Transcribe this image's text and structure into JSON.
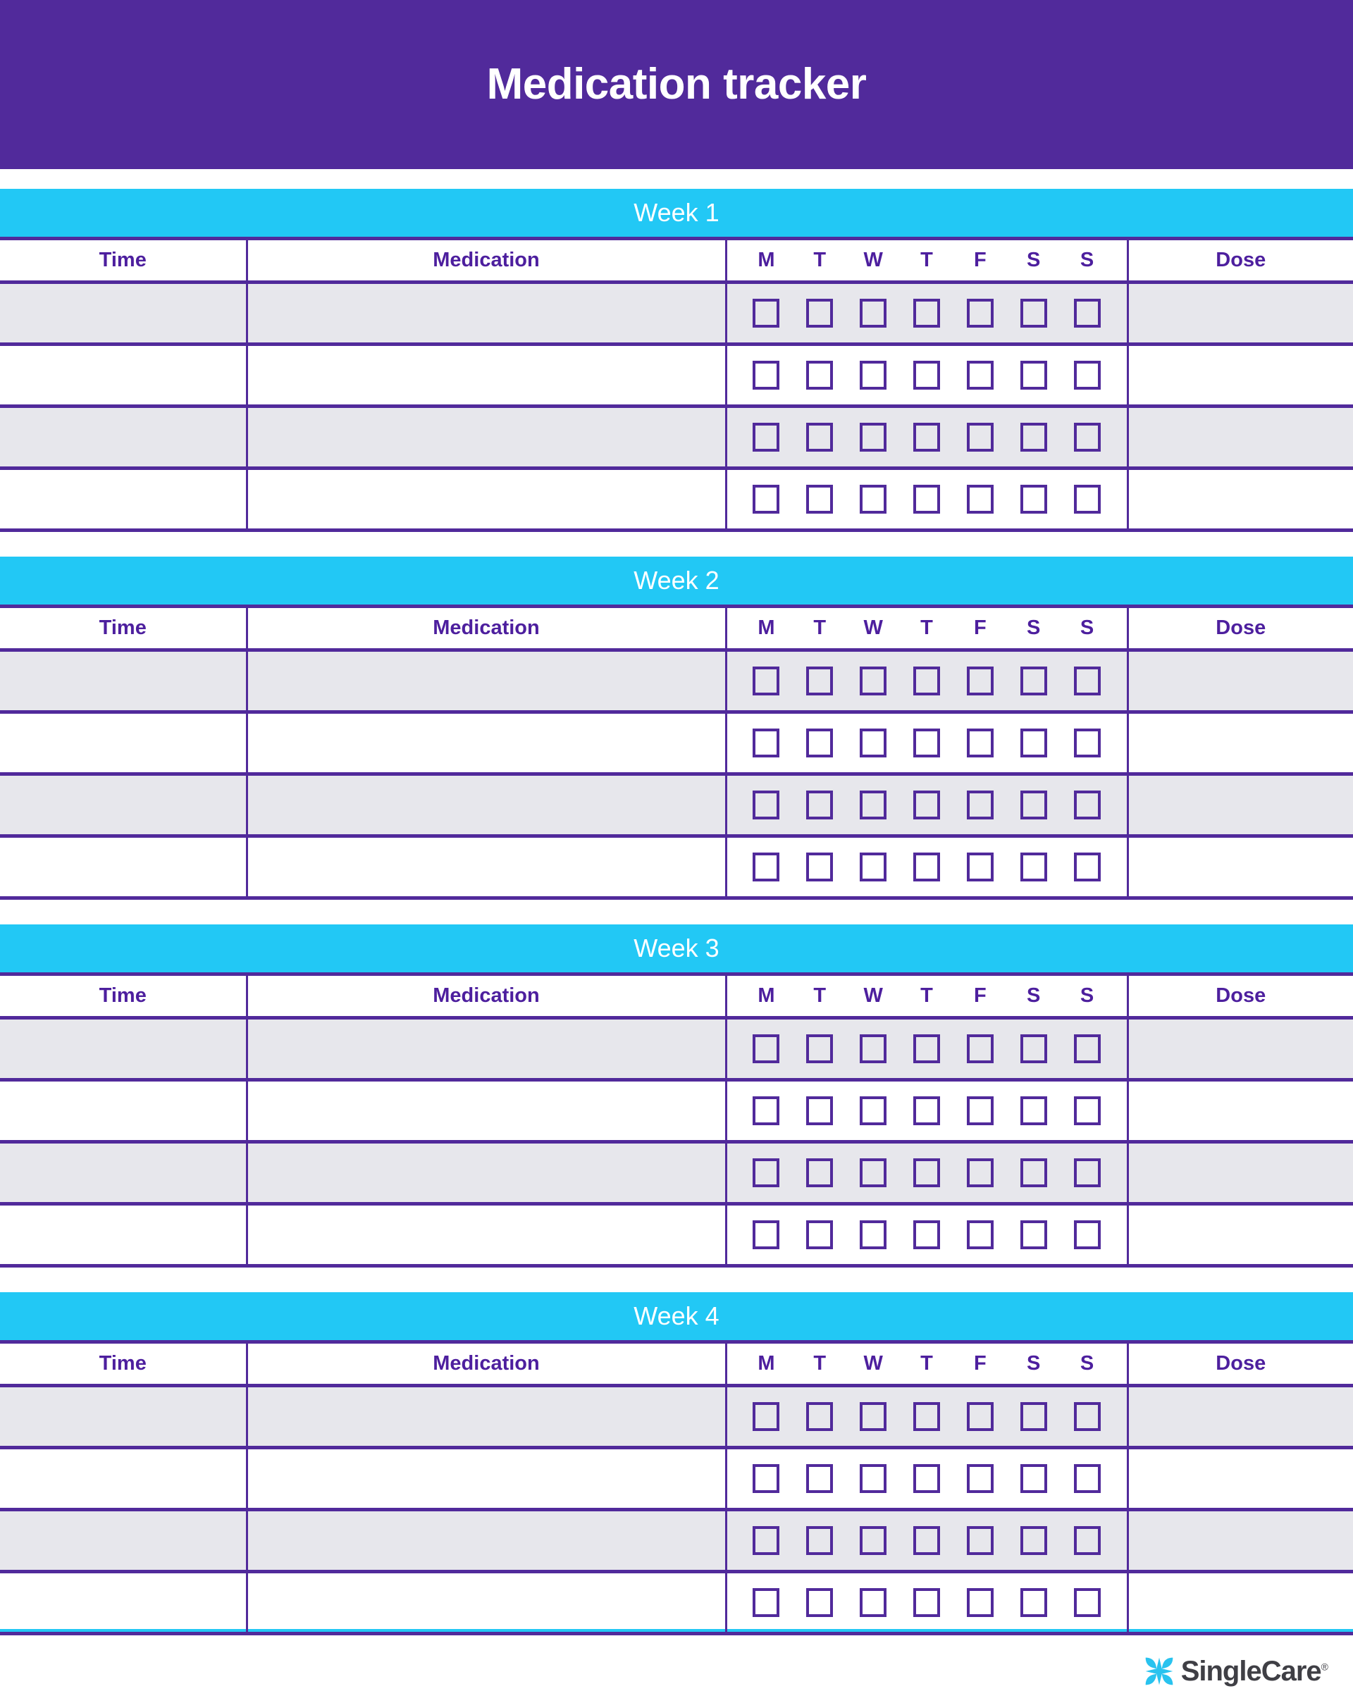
{
  "header": {
    "title": "Medication tracker",
    "background_color": "#512a9b",
    "title_color": "#ffffff"
  },
  "theme": {
    "purple": "#512a9b",
    "purple_text": "#4d1f9e",
    "cyan": "#22c8f5",
    "row_shade": "#e7e7ec",
    "row_plain": "#ffffff",
    "logo_text_color": "#3f3f45"
  },
  "columns": {
    "time": "Time",
    "medication": "Medication",
    "dose": "Dose"
  },
  "days": [
    "M",
    "T",
    "W",
    "T",
    "F",
    "S",
    "S"
  ],
  "weeks": [
    {
      "label": "Week 1",
      "rows": [
        {
          "time": "",
          "medication": "",
          "dose": "",
          "checks": [
            "",
            "",
            "",
            "",
            "",
            "",
            ""
          ]
        },
        {
          "time": "",
          "medication": "",
          "dose": "",
          "checks": [
            "",
            "",
            "",
            "",
            "",
            "",
            ""
          ]
        },
        {
          "time": "",
          "medication": "",
          "dose": "",
          "checks": [
            "",
            "",
            "",
            "",
            "",
            "",
            ""
          ]
        },
        {
          "time": "",
          "medication": "",
          "dose": "",
          "checks": [
            "",
            "",
            "",
            "",
            "",
            "",
            ""
          ]
        }
      ]
    },
    {
      "label": "Week 2",
      "rows": [
        {
          "time": "",
          "medication": "",
          "dose": "",
          "checks": [
            "",
            "",
            "",
            "",
            "",
            "",
            ""
          ]
        },
        {
          "time": "",
          "medication": "",
          "dose": "",
          "checks": [
            "",
            "",
            "",
            "",
            "",
            "",
            ""
          ]
        },
        {
          "time": "",
          "medication": "",
          "dose": "",
          "checks": [
            "",
            "",
            "",
            "",
            "",
            "",
            ""
          ]
        },
        {
          "time": "",
          "medication": "",
          "dose": "",
          "checks": [
            "",
            "",
            "",
            "",
            "",
            "",
            ""
          ]
        }
      ]
    },
    {
      "label": "Week 3",
      "rows": [
        {
          "time": "",
          "medication": "",
          "dose": "",
          "checks": [
            "",
            "",
            "",
            "",
            "",
            "",
            ""
          ]
        },
        {
          "time": "",
          "medication": "",
          "dose": "",
          "checks": [
            "",
            "",
            "",
            "",
            "",
            "",
            ""
          ]
        },
        {
          "time": "",
          "medication": "",
          "dose": "",
          "checks": [
            "",
            "",
            "",
            "",
            "",
            "",
            ""
          ]
        },
        {
          "time": "",
          "medication": "",
          "dose": "",
          "checks": [
            "",
            "",
            "",
            "",
            "",
            "",
            ""
          ]
        }
      ]
    },
    {
      "label": "Week 4",
      "rows": [
        {
          "time": "",
          "medication": "",
          "dose": "",
          "checks": [
            "",
            "",
            "",
            "",
            "",
            "",
            ""
          ]
        },
        {
          "time": "",
          "medication": "",
          "dose": "",
          "checks": [
            "",
            "",
            "",
            "",
            "",
            "",
            ""
          ]
        },
        {
          "time": "",
          "medication": "",
          "dose": "",
          "checks": [
            "",
            "",
            "",
            "",
            "",
            "",
            ""
          ]
        },
        {
          "time": "",
          "medication": "",
          "dose": "",
          "checks": [
            "",
            "",
            "",
            "",
            "",
            "",
            ""
          ]
        }
      ]
    }
  ],
  "footer": {
    "logo_icon": "singlecare-star-icon",
    "logo_name": "SingleCare",
    "trademark": "®"
  }
}
